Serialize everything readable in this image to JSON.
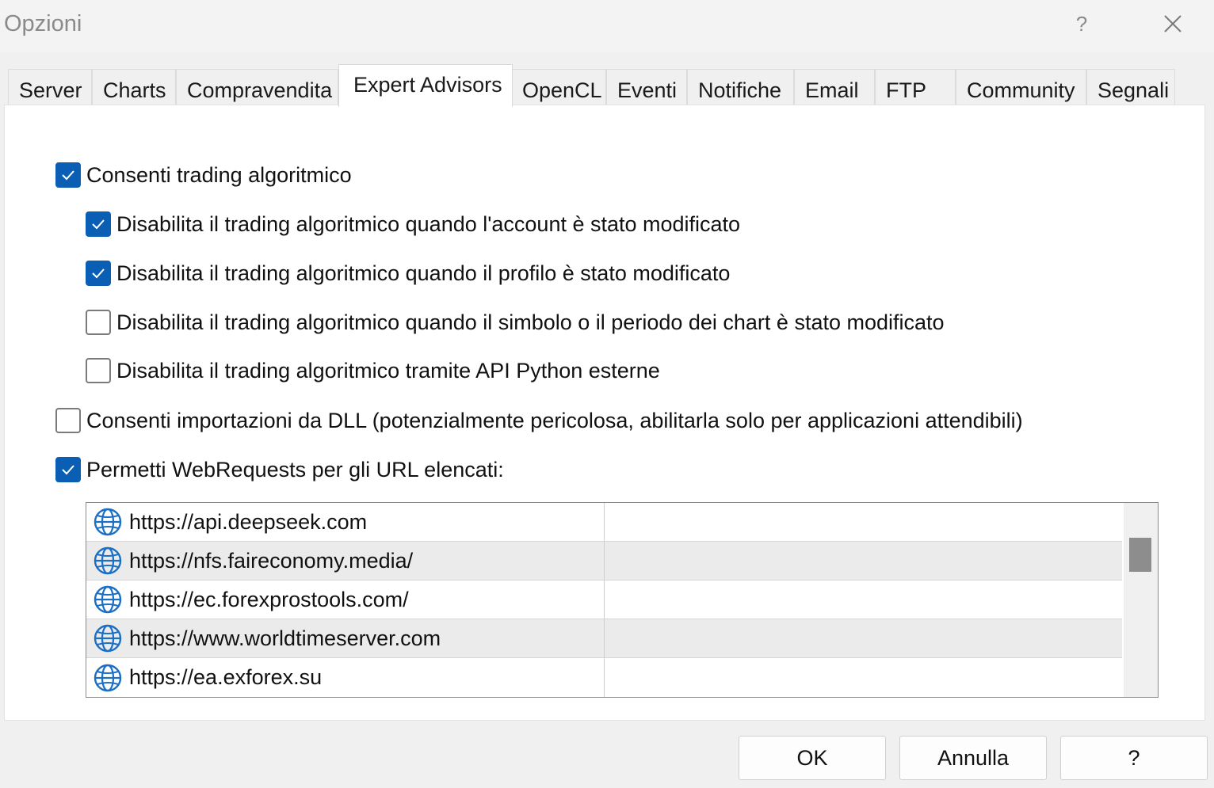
{
  "window": {
    "title": "Opzioni",
    "help_glyph": "?",
    "close_icon": "close-icon"
  },
  "tabs": [
    {
      "label": "Server"
    },
    {
      "label": "Charts"
    },
    {
      "label": "Compravendita"
    },
    {
      "label": "Expert Advisors",
      "active": true
    },
    {
      "label": "OpenCL"
    },
    {
      "label": "Eventi"
    },
    {
      "label": "Notifiche"
    },
    {
      "label": "Email"
    },
    {
      "label": "FTP"
    },
    {
      "label": "Community"
    },
    {
      "label": "Segnali"
    }
  ],
  "options": [
    {
      "label": "Consenti trading algoritmico",
      "checked": true
    },
    {
      "label": "Disabilita il trading algoritmico quando l'account è stato modificato",
      "checked": true
    },
    {
      "label": "Disabilita il trading algoritmico quando il profilo è stato modificato",
      "checked": true
    },
    {
      "label": "Disabilita il trading algoritmico quando il simbolo o il periodo dei chart è stato modificato",
      "checked": false
    },
    {
      "label": "Disabilita il trading algoritmico tramite API Python esterne",
      "checked": false
    },
    {
      "label": "Consenti importazioni da DLL (potenzialmente pericolosa, abilitarla solo per applicazioni attendibili)",
      "checked": false
    },
    {
      "label": "Permetti WebRequests per gli URL elencati:",
      "checked": true
    }
  ],
  "url_list": {
    "row_icon": "globe-icon",
    "items": [
      {
        "url": "https://api.deepseek.com"
      },
      {
        "url": "https://nfs.faireconomy.media/"
      },
      {
        "url": "https://ec.forexprostools.com/"
      },
      {
        "url": "https://www.worldtimeserver.com"
      },
      {
        "url": "https://ea.exforex.su"
      }
    ]
  },
  "buttons": {
    "ok": "OK",
    "cancel": "Annulla",
    "help": "?"
  },
  "colors": {
    "accent": "#0a5fb4",
    "globe": "#1b6fc4"
  }
}
